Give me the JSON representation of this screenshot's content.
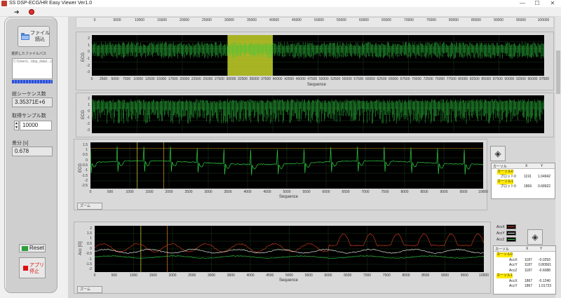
{
  "window": {
    "title": "SS DSP-ECG/HR Easy Viewer Ver1.0",
    "controls": {
      "minimize": "—",
      "maximize": "☐",
      "close": "✕"
    }
  },
  "toolbar": {
    "run_icon": "run-arrow-icon",
    "stop_icon": "abort-icon"
  },
  "left_panel": {
    "file_button": "ファイル読込",
    "selected_file_label": "選択したファイルパス",
    "file_path": "C:\\Users\\...\\dsp_data\\...csv",
    "total_seq_label": "総シーケンス数",
    "total_seq_value": "3.35371E+6",
    "sample_label": "取得サンプル数",
    "sample_value": "10000",
    "time_label": "差分 [s]",
    "time_value": "0.678",
    "reset_button": "Reset",
    "stop_button": "アプリ停止"
  },
  "chart_data": [
    {
      "type": "line",
      "name": "overview-top",
      "xlabel": "Sequence",
      "ylabel": "ECG",
      "x_ticks": [
        "0",
        "5000",
        "10000",
        "15000",
        "20000",
        "25000",
        "30000",
        "35000",
        "40000",
        "45000",
        "50000",
        "55000",
        "60000",
        "65000",
        "70000",
        "75000",
        "80000",
        "85000",
        "90000",
        "95000",
        "100000"
      ],
      "y_ticks": [
        "2",
        "1",
        "0",
        "-1",
        "-2",
        "-3"
      ],
      "xlim": [
        0,
        100000
      ],
      "ylim": [
        -3,
        2
      ],
      "highlight_range": [
        30000,
        40000
      ],
      "color": "#2ecc40"
    },
    {
      "type": "line",
      "name": "overview-middle",
      "xlabel": "Sequence",
      "ylabel": "ECG",
      "x_ticks": [
        "0",
        "2500",
        "5000",
        "7500",
        "10000",
        "12500",
        "15000",
        "17500",
        "20000",
        "22500",
        "25000",
        "27500",
        "30000",
        "32500",
        "35000",
        "37500",
        "40000",
        "42500",
        "45000",
        "47500",
        "50000",
        "52500",
        "55000",
        "57500",
        "60000",
        "62500",
        "65000",
        "67500",
        "70000",
        "72500",
        "75000",
        "77500",
        "80000",
        "82500",
        "85000",
        "87500",
        "90000",
        "92500",
        "95000",
        "97500"
      ],
      "y_ticks": [
        "2",
        "1",
        "0",
        "-1",
        "-2",
        "-3"
      ],
      "xlim": [
        0,
        100000
      ],
      "ylim": [
        -3,
        2
      ],
      "color": "#2ecc40"
    },
    {
      "type": "line",
      "name": "zoom-ecg",
      "xlabel": "Sequence",
      "ylabel": "ECG",
      "x_ticks": [
        "0",
        "1000",
        "2000",
        "3000",
        "4000",
        "5000",
        "6000",
        "7000",
        "8000",
        "9000",
        "10000"
      ],
      "y_ticks": [
        "2",
        "1.5",
        "1",
        "0.5",
        "0",
        "-0.5",
        "-1",
        "-1.5",
        "-2",
        "-2.5"
      ],
      "xlim": [
        0,
        10000
      ],
      "ylim": [
        -2.5,
        2.5
      ],
      "color": "#2ecc40"
    },
    {
      "type": "line",
      "name": "ecg",
      "xlabel": "Sequence",
      "ylabel": "ECG",
      "x_ticks": [
        "0",
        "500",
        "1000",
        "1500",
        "2000",
        "2500",
        "3000",
        "3500",
        "4000",
        "4500",
        "5000",
        "5500",
        "6000",
        "6500",
        "7000",
        "7500",
        "8000",
        "8500",
        "9000",
        "9500",
        "10000"
      ],
      "y_ticks": [
        "1.5",
        "1",
        "0.5",
        "0",
        "-0.5",
        "-1",
        "-1.5",
        "-2",
        "-2.5"
      ],
      "xlim": [
        0,
        10000
      ],
      "ylim": [
        -2.5,
        1.5
      ],
      "cursors": [
        1191,
        1869
      ],
      "color": "#2ecc40"
    },
    {
      "type": "line",
      "name": "accel",
      "xlabel": "Sequence",
      "ylabel": "Acc [G]",
      "x_ticks": [
        "0",
        "500",
        "1000",
        "1500",
        "2000",
        "2500",
        "3000",
        "3500",
        "4000",
        "4500",
        "5000",
        "5500",
        "6000",
        "6500",
        "7000",
        "7500",
        "8000",
        "8500",
        "9000",
        "9500",
        "10000"
      ],
      "y_ticks": [
        "2",
        "1.5",
        "1",
        "0.5",
        "0",
        "-0.5",
        "-1",
        "-1.5",
        "-2"
      ],
      "xlim": [
        0,
        10000
      ],
      "ylim": [
        -2,
        2
      ],
      "cursors": [
        1187,
        1867
      ],
      "series": [
        {
          "name": "AccX",
          "color": "#e04020"
        },
        {
          "name": "AccY",
          "color": "#ffffff"
        },
        {
          "name": "AccZ",
          "color": "#2ecc40"
        }
      ]
    }
  ],
  "ecg_cursor_table": {
    "headers": [
      "カーソル",
      "X",
      "Y"
    ],
    "rows": [
      {
        "label": "カーソル0",
        "sub": "プロット0",
        "x": "1191",
        "y": "1.04942"
      },
      {
        "label": "カーソル1",
        "sub": "プロット0",
        "x": "1869",
        "y": "0.68922"
      }
    ]
  },
  "acc_cursor_table": {
    "headers": [
      "カーソル",
      "X",
      "Y"
    ],
    "rows": [
      {
        "label": "カーソル0",
        "sub": "",
        "x": "",
        "y": ""
      },
      {
        "label": "",
        "sub": "AccX",
        "x": "1187",
        "y": "-0.0293"
      },
      {
        "label": "",
        "sub": "AccY",
        "x": "1187",
        "y": "0.80561"
      },
      {
        "label": "",
        "sub": "AccZ",
        "x": "1187",
        "y": "-0.6088"
      },
      {
        "label": "カーソル1",
        "sub": "",
        "x": "",
        "y": ""
      },
      {
        "label": "",
        "sub": "AccX",
        "x": "1867",
        "y": "-0.1240"
      },
      {
        "label": "",
        "sub": "AccY",
        "x": "1867",
        "y": "1.01723"
      }
    ]
  },
  "graph_tool_labels": [
    "ズーム"
  ]
}
